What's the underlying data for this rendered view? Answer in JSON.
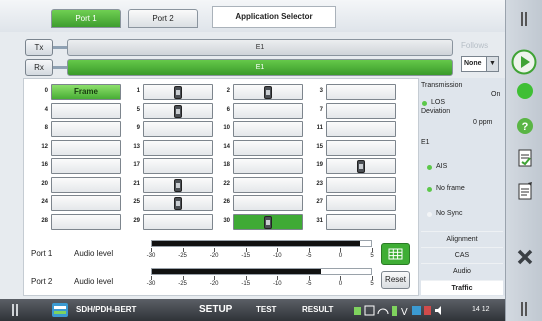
{
  "tabs": [
    {
      "label": "Port 1",
      "active": true
    },
    {
      "label": "Port 2",
      "active": false
    }
  ],
  "app_selector": "Application Selector",
  "paths": {
    "tx_label": "Tx",
    "rx_label": "Rx",
    "tx_value": "E1",
    "rx_value": "E1",
    "follows_label": "Follows",
    "follows_value": "None"
  },
  "timeslots": {
    "frame_label": "Frame",
    "rows": [
      [
        "0",
        "1",
        "2",
        "3"
      ],
      [
        "4",
        "5",
        "6",
        "7"
      ],
      [
        "8",
        "9",
        "10",
        "11"
      ],
      [
        "12",
        "13",
        "14",
        "15"
      ],
      [
        "16",
        "17",
        "18",
        "19"
      ],
      [
        "20",
        "21",
        "22",
        "23"
      ],
      [
        "24",
        "25",
        "26",
        "27"
      ],
      [
        "28",
        "29",
        "30",
        "31"
      ]
    ],
    "phone_slots": [
      "1",
      "2",
      "5",
      "19",
      "21",
      "25",
      "30"
    ],
    "selected_slot": "30"
  },
  "audio": {
    "port1_label": "Port 1",
    "port2_label": "Port 2",
    "level_label": "Audio level",
    "port1_level_pct": 95,
    "port2_level_pct": 77,
    "scale": [
      "-30",
      "-25",
      "-20",
      "-15",
      "-10",
      "-5",
      "0",
      "5"
    ],
    "reset_label": "Reset"
  },
  "status": {
    "transmission_label": "Transmission",
    "transmission_value": "On",
    "los_label": "LOS",
    "deviation_label": "Deviation",
    "deviation_value": "0 ppm",
    "e1_label": "E1",
    "ais_label": "AIS",
    "no_frame_label": "No frame",
    "no_sync_label": "No Sync",
    "buttons": [
      "Alignment",
      "CAS",
      "Audio",
      "Traffic"
    ],
    "selected_button": "Traffic"
  },
  "bottom": {
    "app_name": "SDH/PDH-BERT",
    "setup": "SETUP",
    "test": "TEST",
    "result": "RESULT",
    "clock": "14 12"
  },
  "colors": {
    "accent_green": "#3faa35",
    "status_green": "#5cc84a"
  }
}
